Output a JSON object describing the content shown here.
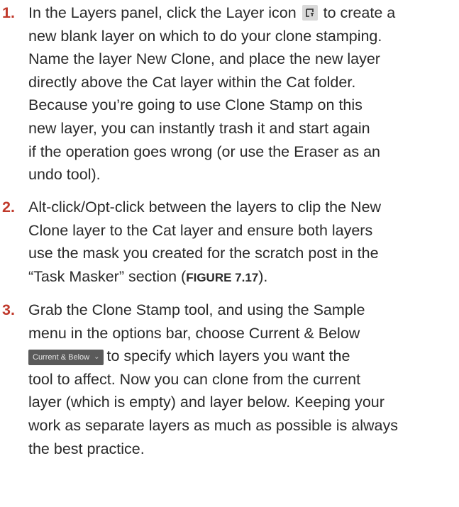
{
  "steps": [
    {
      "number": "1.",
      "lines": [
        {
          "before": "In the Layers panel, click the Layer icon",
          "after": "to create a"
        },
        {
          "text": "new blank layer on which to do your clone stamping."
        },
        {
          "text": "Name the layer New Clone, and place the new layer"
        },
        {
          "text": "directly above the Cat layer within the Cat folder."
        },
        {
          "text": "Because you’re going to use Clone Stamp on this"
        },
        {
          "text": "new layer, you can instantly trash it and start again"
        },
        {
          "text": "if the operation goes wrong (or use the Eraser as an"
        },
        {
          "text": "undo tool)."
        }
      ],
      "icon": "new-layer-icon"
    },
    {
      "number": "2.",
      "lines": [
        {
          "text": "Alt-click/Opt-click between the layers to clip the New"
        },
        {
          "text": "Clone layer to the Cat layer and ensure both layers"
        },
        {
          "text": "use the mask you created for the scratch post in the"
        },
        {
          "before": "“Task Masker” section (",
          "figure": "FIGURE 7.17",
          "after": ")."
        }
      ]
    },
    {
      "number": "3.",
      "lines": [
        {
          "text": "Grab the Clone Stamp tool, and using the Sample"
        },
        {
          "text": "menu in the options bar, choose Current & Below"
        },
        {
          "chip": "Current & Below",
          "after": "to specify which layers you want the"
        },
        {
          "text": "tool to affect. Now you can clone from the current"
        },
        {
          "text": "layer (which is empty) and layer below. Keeping your"
        },
        {
          "text": "work as separate layers as much as possible is always"
        },
        {
          "text": "the best practice."
        }
      ]
    }
  ]
}
